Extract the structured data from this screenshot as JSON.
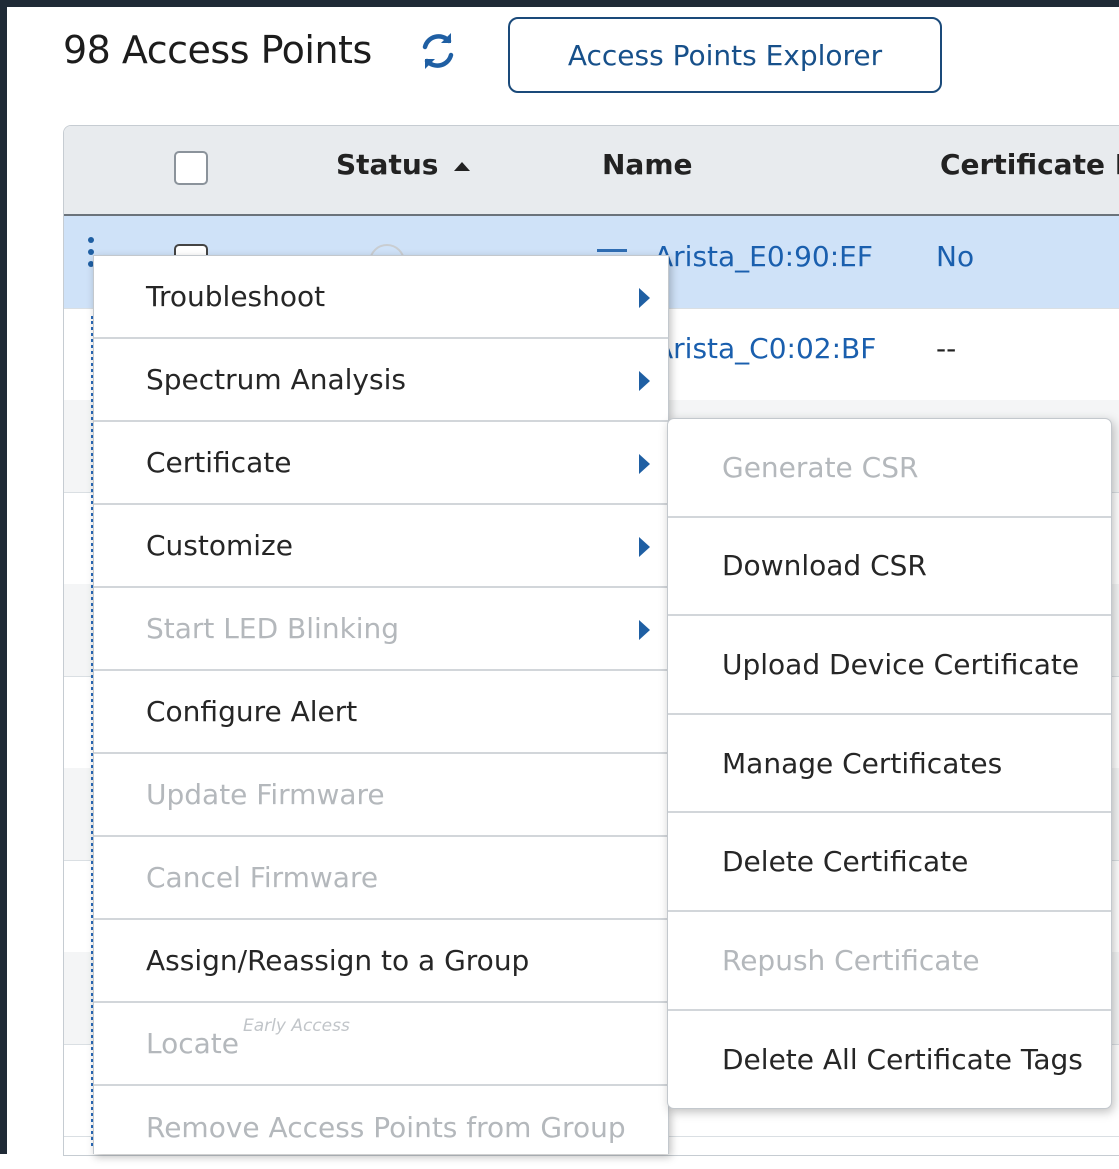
{
  "header": {
    "title": "98 Access Points",
    "explorer_button": "Access Points Explorer"
  },
  "table": {
    "columns": [
      "Status",
      "Name",
      "Certificate I"
    ],
    "rows": [
      {
        "name": "Arista_E0:90:EF",
        "certificate": "No",
        "selected": true
      },
      {
        "name": "Arista_C0:02:BF",
        "certificate": "--",
        "selected": false
      }
    ]
  },
  "context_menu": {
    "items": [
      {
        "label": "Troubleshoot",
        "enabled": true,
        "submenu": true
      },
      {
        "label": "Spectrum Analysis",
        "enabled": true,
        "submenu": true
      },
      {
        "label": "Certificate",
        "enabled": true,
        "submenu": true
      },
      {
        "label": "Customize",
        "enabled": true,
        "submenu": true
      },
      {
        "label": "Start LED Blinking",
        "enabled": false,
        "submenu": true
      },
      {
        "label": "Configure Alert",
        "enabled": true,
        "submenu": false
      },
      {
        "label": "Update Firmware",
        "enabled": false,
        "submenu": false
      },
      {
        "label": "Cancel Firmware",
        "enabled": false,
        "submenu": false
      },
      {
        "label": "Assign/Reassign to a Group",
        "enabled": true,
        "submenu": false
      },
      {
        "label": "Locate",
        "badge": "Early Access",
        "enabled": false,
        "submenu": false
      },
      {
        "label": "Remove Access Points from Group",
        "enabled": false,
        "submenu": false
      }
    ]
  },
  "certificate_submenu": {
    "items": [
      {
        "label": "Generate CSR",
        "enabled": false
      },
      {
        "label": "Download CSR",
        "enabled": true
      },
      {
        "label": "Upload Device Certificate",
        "enabled": true
      },
      {
        "label": "Manage Certificates",
        "enabled": true
      },
      {
        "label": "Delete Certificate",
        "enabled": true
      },
      {
        "label": "Repush Certificate",
        "enabled": false
      },
      {
        "label": "Delete All Certificate Tags",
        "enabled": true
      }
    ]
  },
  "colors": {
    "accent": "#1f5fa3",
    "link": "#1a5fae",
    "selected_row": "#cfe2f8",
    "disabled_text": "#b4b8bc"
  }
}
